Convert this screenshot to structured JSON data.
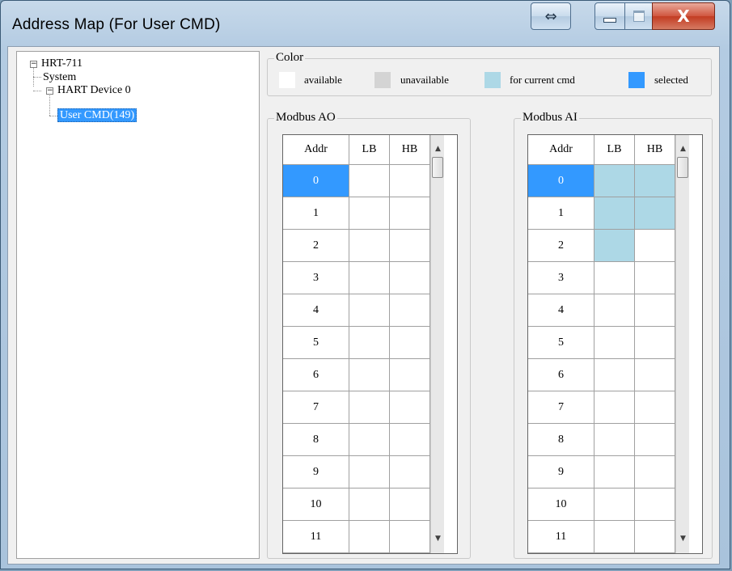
{
  "window": {
    "title": "Address Map (For User CMD)"
  },
  "titlebar_buttons": {
    "resize_glyph": "⇔",
    "close_glyph": "X"
  },
  "tree": {
    "root": "HRT-711",
    "system": "System",
    "device": "HART Device 0",
    "user_cmd": "User CMD(149)"
  },
  "color_legend": {
    "title": "Color",
    "items": [
      {
        "label": "available",
        "color": "#ffffff"
      },
      {
        "label": "unavailable",
        "color": "#d4d4d4"
      },
      {
        "label": "for current cmd",
        "color": "#add8e6"
      },
      {
        "label": "selected",
        "color": "#3399ff"
      }
    ]
  },
  "modbus_ao": {
    "title": "Modbus AO",
    "headers": [
      "Addr",
      "LB",
      "HB"
    ],
    "rows": [
      "0",
      "1",
      "2",
      "3",
      "4",
      "5",
      "6",
      "7",
      "8",
      "9",
      "10",
      "11"
    ],
    "selected_row": 0,
    "highlighted_cells": []
  },
  "modbus_ai": {
    "title": "Modbus AI",
    "headers": [
      "Addr",
      "LB",
      "HB"
    ],
    "rows": [
      "0",
      "1",
      "2",
      "3",
      "4",
      "5",
      "6",
      "7",
      "8",
      "9",
      "10",
      "11"
    ],
    "selected_row": 0,
    "highlighted_cells": [
      [
        0,
        "LB"
      ],
      [
        0,
        "HB"
      ],
      [
        1,
        "LB"
      ],
      [
        1,
        "HB"
      ],
      [
        2,
        "LB"
      ]
    ]
  },
  "scrollbar": {
    "up_glyph": "▲",
    "down_glyph": "▼"
  }
}
